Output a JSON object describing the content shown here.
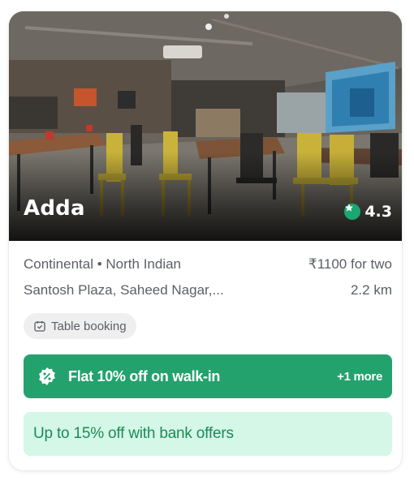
{
  "restaurant": {
    "name": "Adda",
    "rating": "4.3",
    "cuisines": "Continental • North Indian",
    "price": "₹1100 for two",
    "address": "Santosh Plaza, Saheed Nagar,...",
    "distance": "2.2 km",
    "photo_description_icon": "restaurant-interior-photo"
  },
  "chips": {
    "table_booking": "Table booking"
  },
  "offers": {
    "main": "Flat 10% off on walk-in",
    "more": "+1 more",
    "bank": "Up to 15% off with bank offers"
  },
  "colors": {
    "rating_badge": "#1ba672",
    "offer_main_bg": "#23a26d",
    "offer_bank_bg": "#d4f7e7",
    "offer_bank_text": "#1e8a56"
  }
}
